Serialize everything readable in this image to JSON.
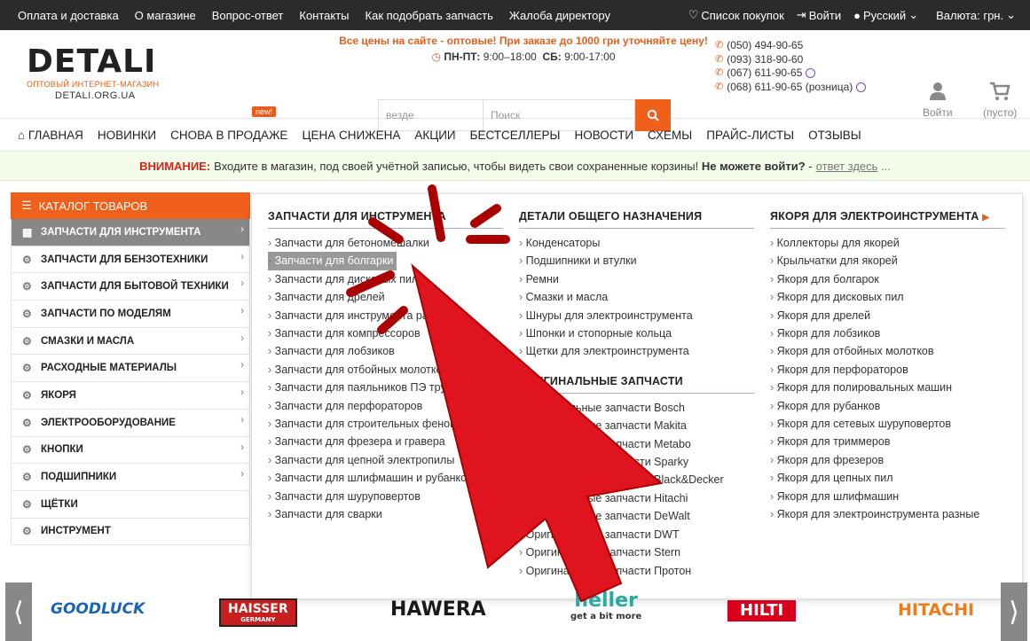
{
  "topbar": {
    "links": [
      "Оплата и доставка",
      "О магазине",
      "Вопрос-ответ",
      "Контакты",
      "Как подобрать запчасть",
      "Жалоба директору"
    ],
    "wishlist": "Список покупок",
    "login": "Войти",
    "language": "Русский",
    "currency": "Валюта: грн."
  },
  "logo": {
    "word": "DETALI",
    "tagline": "ОПТОВЫЙ ИНТЕРНЕТ-МАГАЗИН",
    "domain": "DETALI.ORG.UA"
  },
  "promo": {
    "line1": "Все цены на сайте - оптовые! При заказе до 1000 грн уточняйте цену!",
    "hours_label1": "ПН-ПТ:",
    "hours1": "9:00–18:00",
    "hours_label2": "СБ:",
    "hours2": "9:00-17:00"
  },
  "search": {
    "where": "везде",
    "placeholder": "Поиск"
  },
  "phones": [
    "(050) 494-90-65",
    "(093) 318-90-60",
    "(067) 611-90-65",
    "(068) 611-90-65 (розница)"
  ],
  "account": {
    "label": "Войти"
  },
  "cart": {
    "label": "(пусто)"
  },
  "nav": {
    "items": [
      "ГЛАВНАЯ",
      "НОВИНКИ",
      "СНОВА В ПРОДАЖЕ",
      "ЦЕНА СНИЖЕНА",
      "АКЦИИ",
      "БЕСТСЕЛЛЕРЫ",
      "НОВОСТИ",
      "СХЕМЫ",
      "ПРАЙС-ЛИСТЫ",
      "ОТЗЫВЫ"
    ],
    "badge": "new!"
  },
  "notice": {
    "warn": "ВНИМАНИЕ:",
    "text": "Входите в магазин, под своей учётной записью, чтобы видеть свои сохраненные корзины!",
    "bold": "Не можете войти?",
    "dash": "-",
    "link": "ответ здесь",
    "dots": "..."
  },
  "catalog": {
    "title": "КАТАЛОГ ТОВАРОВ",
    "items": [
      "ЗАПЧАСТИ ДЛЯ ИНСТРУМЕНТА",
      "ЗАПЧАСТИ ДЛЯ БЕНЗОТЕХНИКИ",
      "ЗАПЧАСТИ ДЛЯ БЫТОВОЙ ТЕХНИКИ",
      "ЗАПЧАСТИ ПО МОДЕЛЯМ",
      "СМАЗКИ И МАСЛА",
      "РАСХОДНЫЕ МАТЕРИАЛЫ",
      "ЯКОРЯ",
      "ЭЛЕКТРООБОРУДОВАНИЕ",
      "КНОПКИ",
      "ПОДШИПНИКИ",
      "ЩЁТКИ",
      "ИНСТРУМЕНТ"
    ]
  },
  "mega": {
    "col1": {
      "title": "ЗАПЧАСТИ ДЛЯ ИНСТРУМЕНТА",
      "links": [
        "Запчасти для бетономешалки",
        "Запчасти для болгарки",
        "Запчасти для дисковых пил",
        "Запчасти для дрелей",
        "Запчасти для инструмента разные",
        "Запчасти для компрессоров",
        "Запчасти для лобзиков",
        "Запчасти для отбойных молотков",
        "Запчасти для паяльников ПЭ труб",
        "Запчасти для перфораторов",
        "Запчасти для строительных фенов",
        "Запчасти для фрезера и гравера",
        "Запчасти для цепной электропилы",
        "Запчасти для шлифмашин и рубанков",
        "Запчасти для шуруповертов",
        "Запчасти для сварки"
      ]
    },
    "col2": {
      "title": "ДЕТАЛИ ОБЩЕГО НАЗНАЧЕНИЯ",
      "links": [
        "Конденсаторы",
        "Подшипники и втулки",
        "Ремни",
        "Смазки и масла",
        "Шнуры для электроинструмента",
        "Шпонки и стопорные кольца",
        "Щетки для электроинструмента"
      ]
    },
    "col2b": {
      "title": "ОРИГИНАЛЬНЫЕ ЗАПЧАСТИ",
      "links": [
        "Оригинальные запчасти Bosch",
        "Оригинальные запчасти Makita",
        "Оригинальные запчасти Metabo",
        "Оригинальные запчасти Sparky",
        "Оригинальные запчасти Black&Decker",
        "Оригинальные запчасти Hitachi",
        "Оригинальные запчасти DeWalt",
        "Оригинальные запчасти DWT",
        "Оригинальные запчасти Stern",
        "Оригинальные запчасти Протон"
      ]
    },
    "col3": {
      "title": "ЯКОРЯ ДЛЯ ЭЛЕКТРОИНСТРУМЕНТА",
      "links": [
        "Коллекторы для якорей",
        "Крыльчатки для якорей",
        "Якоря для болгарок",
        "Якоря для дисковых пил",
        "Якоря для дрелей",
        "Якоря для лобзиков",
        "Якоря для отбойных молотков",
        "Якоря для перфораторов",
        "Якоря для полировальных машин",
        "Якоря для рубанков",
        "Якоря для сетевых шуруповертов",
        "Якоря для триммеров",
        "Якоря для фрезеров",
        "Якоря для цепных пил",
        "Якоря для шлифмашин",
        "Якоря для электроинструмента разные"
      ]
    }
  },
  "brands": [
    {
      "name": "GOODLUCK",
      "color": "#1b63b5"
    },
    {
      "name": "HAISSER",
      "color": "#ffffff"
    },
    {
      "name": "HAWERA",
      "color": "#1a1a1a"
    },
    {
      "name": "heller",
      "color": "#2aa9a0"
    },
    {
      "name": "HILTI",
      "color": "#ffffff"
    },
    {
      "name": "HITACHI",
      "color": "#f07a1a"
    }
  ],
  "brand_extra": {
    "heller_tag": "get a bit more",
    "haisser_sub": "GERMANY"
  },
  "colors": {
    "accent": "#f0601b",
    "topbar": "#2b2b2b",
    "cursor": "#e0141e"
  }
}
